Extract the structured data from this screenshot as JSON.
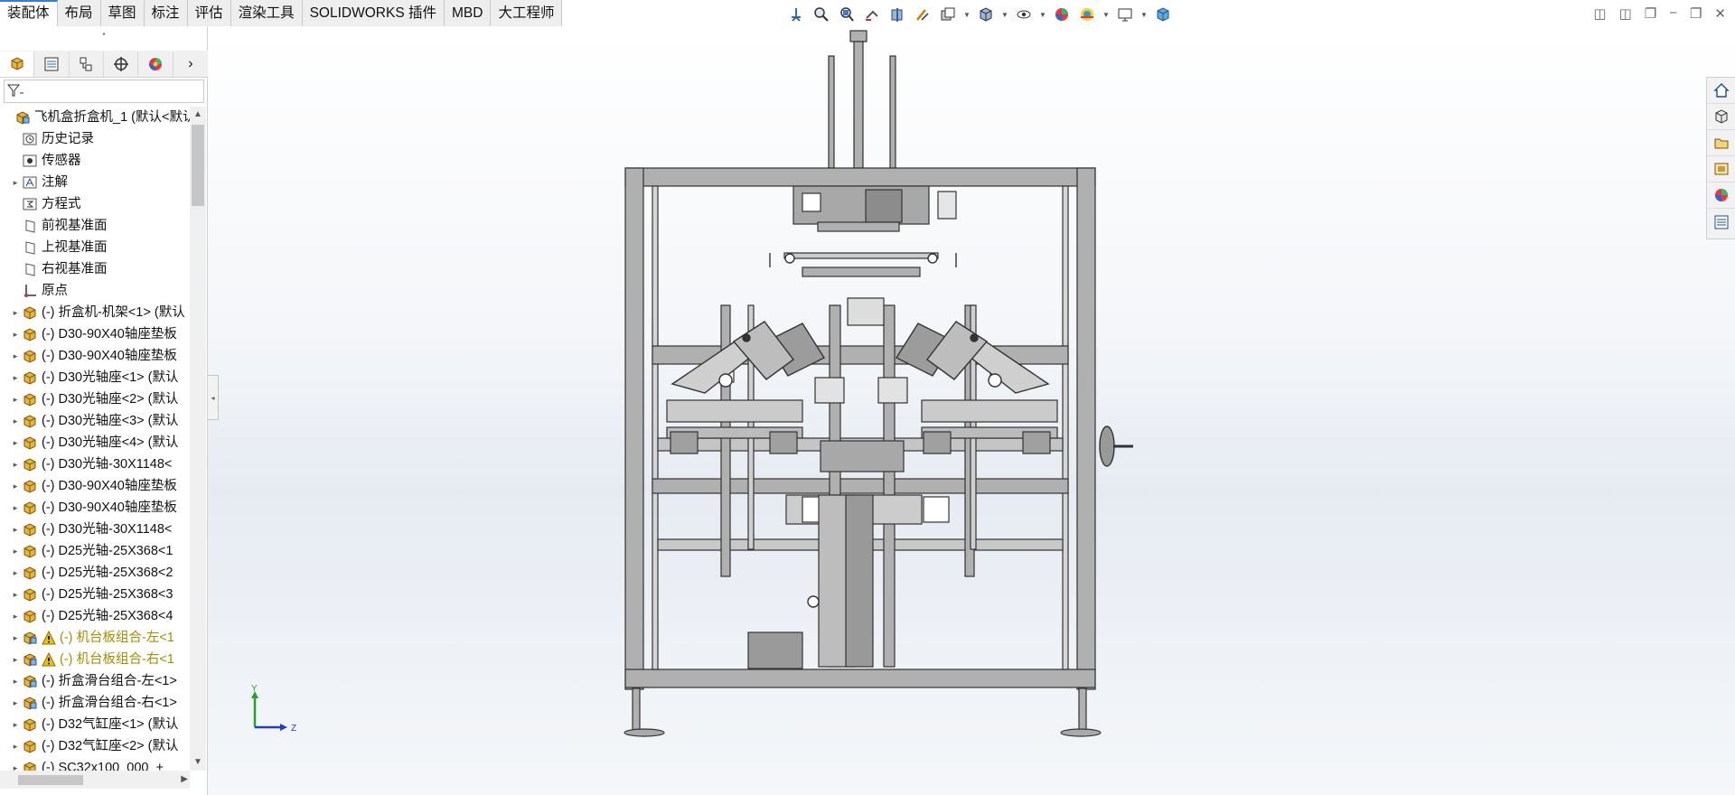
{
  "command_tabs": [
    "装配体",
    "布局",
    "草图",
    "标注",
    "评估",
    "渲染工具",
    "SOLIDWORKS 插件",
    "MBD",
    "大工程师"
  ],
  "active_tab": "装配体",
  "heads_up_toolbar": [
    "view-orientation-icon",
    "zoom-to-fit-icon",
    "zoom-area-icon",
    "previous-view-icon",
    "section-view-icon",
    "dynamic-annotation-icon",
    "view-layout-icon",
    "display-style-icon",
    "hide-show-icon",
    "edit-appearance-icon",
    "scene-icon",
    "view-settings-icon",
    "3d-view-icon"
  ],
  "feature_tabs": [
    "feature-manager-icon",
    "property-manager-icon",
    "configuration-manager-icon",
    "dimxpert-icon",
    "display-manager-icon",
    "more-chevron-icon"
  ],
  "tree": [
    {
      "label": "飞机盒折盒机_1  (默认<默认",
      "icon": "assembly",
      "expand": "",
      "indent": 0,
      "warn": false
    },
    {
      "label": "历史记录",
      "icon": "history",
      "expand": "",
      "indent": 1,
      "warn": false
    },
    {
      "label": "传感器",
      "icon": "sensor",
      "expand": "",
      "indent": 1,
      "warn": false
    },
    {
      "label": "注解",
      "icon": "annotation",
      "expand": "▸",
      "indent": 1,
      "warn": false
    },
    {
      "label": "方程式",
      "icon": "equation",
      "expand": "",
      "indent": 1,
      "warn": false
    },
    {
      "label": "前视基准面",
      "icon": "plane",
      "expand": "",
      "indent": 1,
      "warn": false
    },
    {
      "label": "上视基准面",
      "icon": "plane",
      "expand": "",
      "indent": 1,
      "warn": false
    },
    {
      "label": "右视基准面",
      "icon": "plane",
      "expand": "",
      "indent": 1,
      "warn": false
    },
    {
      "label": "原点",
      "icon": "origin",
      "expand": "",
      "indent": 1,
      "warn": false
    },
    {
      "label": "(-) 折盒机-机架<1> (默认",
      "icon": "part",
      "expand": "▸",
      "indent": 1,
      "warn": false
    },
    {
      "label": "(-) D30-90X40轴座垫板",
      "icon": "part",
      "expand": "▸",
      "indent": 1,
      "warn": false
    },
    {
      "label": "(-) D30-90X40轴座垫板",
      "icon": "part",
      "expand": "▸",
      "indent": 1,
      "warn": false
    },
    {
      "label": "(-) D30光轴座<1> (默认",
      "icon": "part",
      "expand": "▸",
      "indent": 1,
      "warn": false
    },
    {
      "label": "(-) D30光轴座<2> (默认",
      "icon": "part",
      "expand": "▸",
      "indent": 1,
      "warn": false
    },
    {
      "label": "(-) D30光轴座<3> (默认",
      "icon": "part",
      "expand": "▸",
      "indent": 1,
      "warn": false
    },
    {
      "label": "(-) D30光轴座<4> (默认",
      "icon": "part",
      "expand": "▸",
      "indent": 1,
      "warn": false
    },
    {
      "label": "(-) D30光轴-30X1148<",
      "icon": "part",
      "expand": "▸",
      "indent": 1,
      "warn": false
    },
    {
      "label": "(-) D30-90X40轴座垫板",
      "icon": "part",
      "expand": "▸",
      "indent": 1,
      "warn": false
    },
    {
      "label": "(-) D30-90X40轴座垫板",
      "icon": "part",
      "expand": "▸",
      "indent": 1,
      "warn": false
    },
    {
      "label": "(-) D30光轴-30X1148<",
      "icon": "part",
      "expand": "▸",
      "indent": 1,
      "warn": false
    },
    {
      "label": "(-) D25光轴-25X368<1",
      "icon": "part",
      "expand": "▸",
      "indent": 1,
      "warn": false
    },
    {
      "label": "(-) D25光轴-25X368<2",
      "icon": "part",
      "expand": "▸",
      "indent": 1,
      "warn": false
    },
    {
      "label": "(-) D25光轴-25X368<3",
      "icon": "part",
      "expand": "▸",
      "indent": 1,
      "warn": false
    },
    {
      "label": "(-) D25光轴-25X368<4",
      "icon": "part",
      "expand": "▸",
      "indent": 1,
      "warn": false
    },
    {
      "label": "(-) 机台板组合-左<1",
      "icon": "assembly",
      "expand": "▸",
      "indent": 1,
      "warn": true
    },
    {
      "label": "(-) 机台板组合-右<1",
      "icon": "assembly",
      "expand": "▸",
      "indent": 1,
      "warn": true
    },
    {
      "label": "(-) 折盒滑台组合-左<1>",
      "icon": "assembly",
      "expand": "▸",
      "indent": 1,
      "warn": false
    },
    {
      "label": "(-) 折盒滑台组合-右<1>",
      "icon": "assembly",
      "expand": "▸",
      "indent": 1,
      "warn": false
    },
    {
      "label": "(-) D32气缸座<1> (默认",
      "icon": "part",
      "expand": "▸",
      "indent": 1,
      "warn": false
    },
    {
      "label": "(-) D32气缸座<2> (默认",
      "icon": "part",
      "expand": "▸",
      "indent": 1,
      "warn": false
    },
    {
      "label": "(-) SC32x100_000_+",
      "icon": "part",
      "expand": "▸",
      "indent": 1,
      "warn": false
    }
  ],
  "task_pane": [
    "home-icon",
    "design-library-icon",
    "file-explorer-icon",
    "view-palette-icon",
    "appearances-icon",
    "custom-properties-icon"
  ],
  "triad": {
    "y_label": "Y",
    "z_label": "Z"
  },
  "colors": {
    "accent": "#3a7bd5",
    "part_yellow": "#e8b43a",
    "warning": "#e8b400"
  }
}
